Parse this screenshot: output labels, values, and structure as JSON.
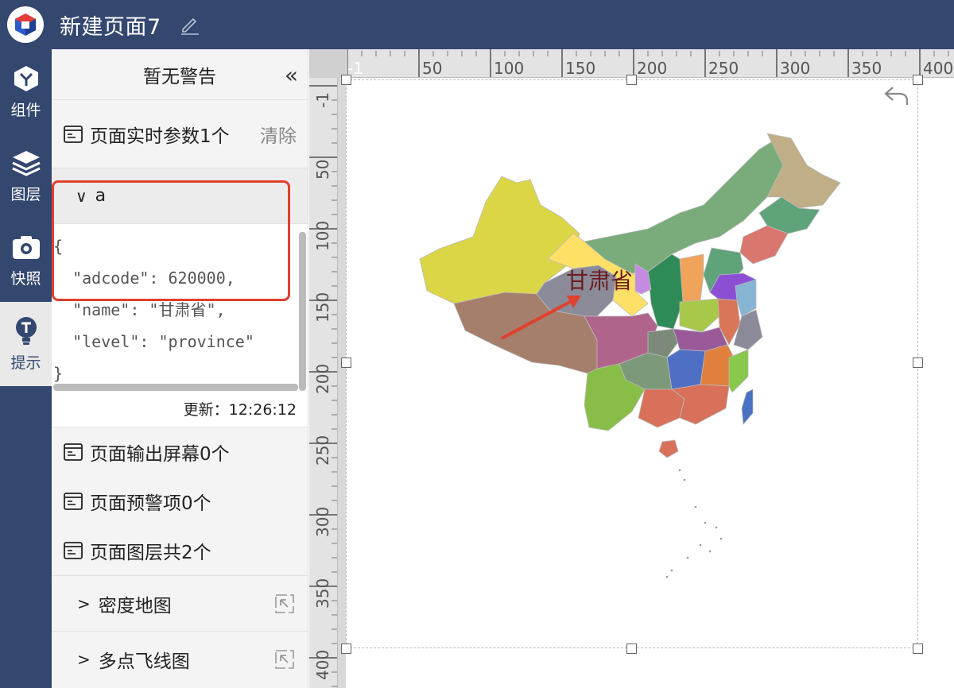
{
  "app": {
    "page_title": "新建页面7"
  },
  "nav": [
    {
      "label": "组件",
      "icon": "component-icon"
    },
    {
      "label": "图层",
      "icon": "layers-icon"
    },
    {
      "label": "快照",
      "icon": "camera-icon"
    },
    {
      "label": "提示",
      "icon": "hint-icon"
    }
  ],
  "panel": {
    "header": "暂无警告",
    "collapse_glyph": "«",
    "realtime_params": "页面实时参数1个",
    "clear_label": "清除",
    "param_name": "a",
    "code_lines": [
      "{",
      "  \"adcode\": 620000,",
      "  \"name\": \"甘肃省\",",
      "  \"level\": \"province\"",
      "}"
    ],
    "updated": "更新：12:26:12",
    "output_screens": "页面输出屏幕0个",
    "warnings": "页面预警项0个",
    "layers_total": "页面图层共2个",
    "layers": [
      "密度地图",
      "多点飞线图"
    ]
  },
  "ruler": {
    "top_ticks": [
      "-1",
      "50",
      "100",
      "150",
      "200",
      "250",
      "300",
      "350",
      "400"
    ],
    "left_ticks": [
      "-1",
      "50",
      "100",
      "150",
      "200",
      "250",
      "300",
      "350",
      "400"
    ]
  },
  "map": {
    "highlight_label": "甘肃省",
    "colors": {
      "xinjiang": "#dbd645",
      "tibet": "#a67f6c",
      "qinghai": "#8a8a99",
      "gansu": "#ffe066",
      "neimenggu": "#7aab7a",
      "heilongjiang": "#bfae86",
      "jilin": "#5ea37a",
      "liaoning": "#d9766e",
      "sichuan": "#b0648c",
      "yunnan": "#88be48",
      "shandong": "#8c4fd4",
      "henan": "#a8c84a",
      "hunan": "#4f6fc4",
      "guangdong": "#d9705a",
      "taiwan": "#4a72c4",
      "arrow": "#e0402e"
    }
  }
}
